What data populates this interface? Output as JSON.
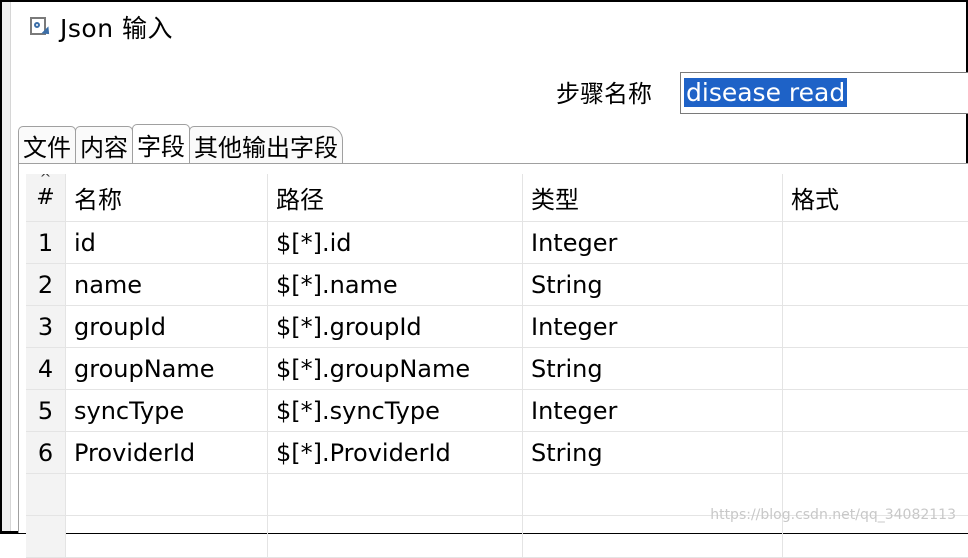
{
  "window": {
    "title": "Json 输入",
    "icon": "json-input-icon"
  },
  "step": {
    "label": "步骤名称",
    "value": "disease read"
  },
  "tabs": [
    {
      "label": "文件"
    },
    {
      "label": "内容"
    },
    {
      "label": "字段",
      "active": true
    },
    {
      "label": "其他输出字段"
    }
  ],
  "table": {
    "headers": {
      "num": "#",
      "name": "名称",
      "path": "路径",
      "type": "类型",
      "format": "格式"
    },
    "rows": [
      {
        "num": "1",
        "name": "id",
        "path": "$[*].id",
        "type": "Integer",
        "format": ""
      },
      {
        "num": "2",
        "name": "name",
        "path": "$[*].name",
        "type": "String",
        "format": ""
      },
      {
        "num": "3",
        "name": "groupId",
        "path": "$[*].groupId",
        "type": "Integer",
        "format": ""
      },
      {
        "num": "4",
        "name": "groupName",
        "path": "$[*].groupName",
        "type": "String",
        "format": ""
      },
      {
        "num": "5",
        "name": "syncType",
        "path": "$[*].syncType",
        "type": "Integer",
        "format": ""
      },
      {
        "num": "6",
        "name": "ProviderId",
        "path": "$[*].ProviderId",
        "type": "String",
        "format": ""
      }
    ]
  },
  "watermark": "https://blog.csdn.net/qq_34082113"
}
